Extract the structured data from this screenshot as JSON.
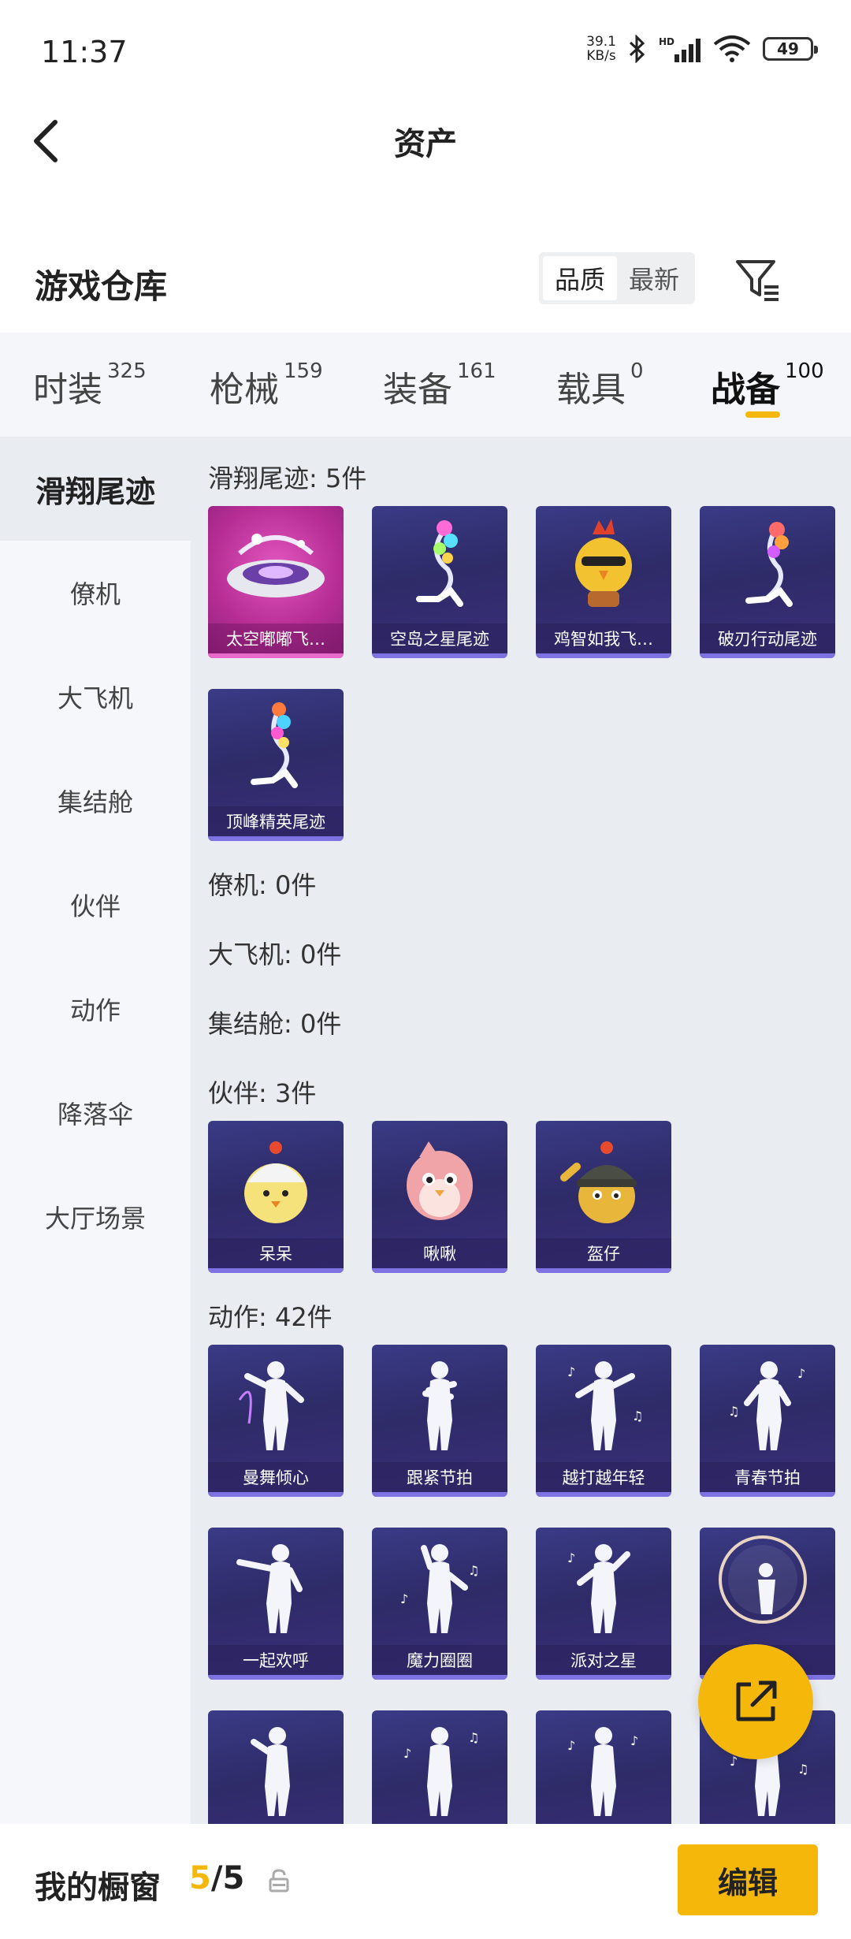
{
  "status": {
    "time": "11:37",
    "net_speed_value": "39.1",
    "net_speed_unit": "KB/s",
    "battery": "49"
  },
  "header": {
    "title": "资产",
    "back_icon": "chevron-left-icon"
  },
  "warehouse": {
    "title": "游戏仓库",
    "sort_options": [
      "品质",
      "最新"
    ],
    "active_sort": "品质",
    "filter_icon": "filter-icon"
  },
  "tabs": [
    {
      "label": "时装",
      "count": "325"
    },
    {
      "label": "枪械",
      "count": "159"
    },
    {
      "label": "装备",
      "count": "161"
    },
    {
      "label": "载具",
      "count": "0"
    },
    {
      "label": "战备",
      "count": "100"
    }
  ],
  "active_tab": "战备",
  "side_nav": [
    "滑翔尾迹",
    "僚机",
    "大飞机",
    "集结舱",
    "伙伴",
    "动作",
    "降落伞",
    "大厅场景"
  ],
  "active_side": "滑翔尾迹",
  "sections": [
    {
      "header": "滑翔尾迹: 5件",
      "items": [
        "太空嘟嘟飞…",
        "空岛之星尾迹",
        "鸡智如我飞…",
        "破刃行动尾迹",
        "顶峰精英尾迹"
      ]
    },
    {
      "header": "僚机: 0件",
      "items": []
    },
    {
      "header": "大飞机: 0件",
      "items": []
    },
    {
      "header": "集结舱: 0件",
      "items": []
    },
    {
      "header": "伙伴: 3件",
      "items": [
        "呆呆",
        "啾啾",
        "盔仔"
      ]
    },
    {
      "header": "动作: 42件",
      "items": [
        "曼舞倾心",
        "跟紧节拍",
        "越打越年轻",
        "青春节拍",
        "一起欢呼",
        "魔力圈圈",
        "派对之星",
        "",
        "",
        "",
        "",
        ""
      ]
    }
  ],
  "fab": {
    "icon": "share-icon"
  },
  "bottom": {
    "label": "我的橱窗",
    "current": "5",
    "total": "/5",
    "lock_icon": "lock-icon",
    "edit_label": "编辑"
  },
  "colors": {
    "accent": "#f5b80a",
    "card_dark": "#2e2b68",
    "card_pink": "#b72e95"
  }
}
